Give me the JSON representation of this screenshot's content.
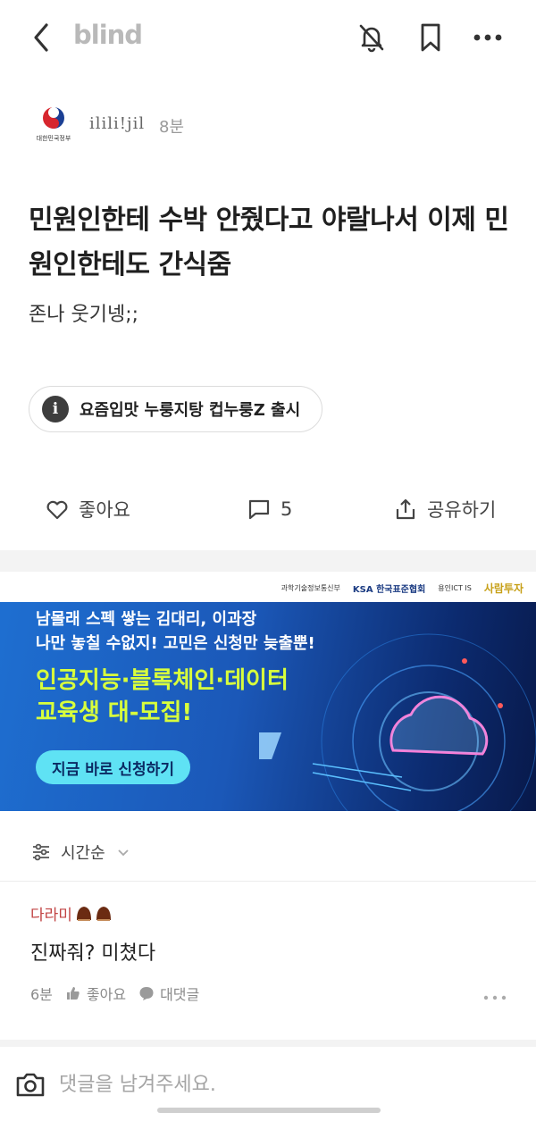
{
  "header": {
    "logo": "blind",
    "icons": [
      "back-icon",
      "bell-off-icon",
      "bookmark-icon",
      "more-icon"
    ]
  },
  "post": {
    "org_logo_caption": "대한민국정부",
    "author": "ilili!jil",
    "time": "8분",
    "title": "민원인한테 수박 안줬다고 야랄나서 이제 민원인한테도 간식줌",
    "body": "존나 웃기넹;;",
    "topic_chip": "요즘입맛 누룽지탕 컵누룽Z 출시"
  },
  "actions": {
    "like_label": "좋아요",
    "comment_count": "5",
    "share_label": "공유하기"
  },
  "ad": {
    "sponsors": [
      "과학기술정보통신부",
      "KSA 한국표준협회",
      "용인ICT IS",
      "사람투자"
    ],
    "line1": "남몰래 스펙 쌓는 김대리, 이과장",
    "line2": "나만 놓칠 수없지! 고민은 신청만 늦출뿐!",
    "headline1": "인공지능·블록체인·데이터",
    "headline2": "교육생 대-모집!",
    "cta": "지금 바로 신청하기",
    "colors": {
      "bg": "#1b58b8",
      "headline": "#d8ff3c",
      "cta_bg": "#5fe2f4"
    }
  },
  "comments": {
    "sort_label": "시간순",
    "items": [
      {
        "author": "다라미",
        "text": "진짜줘? 미쳤다",
        "time": "6분",
        "like_label": "좋아요",
        "reply_label": "대댓글"
      }
    ]
  },
  "composer": {
    "placeholder": "댓글을 남겨주세요."
  }
}
